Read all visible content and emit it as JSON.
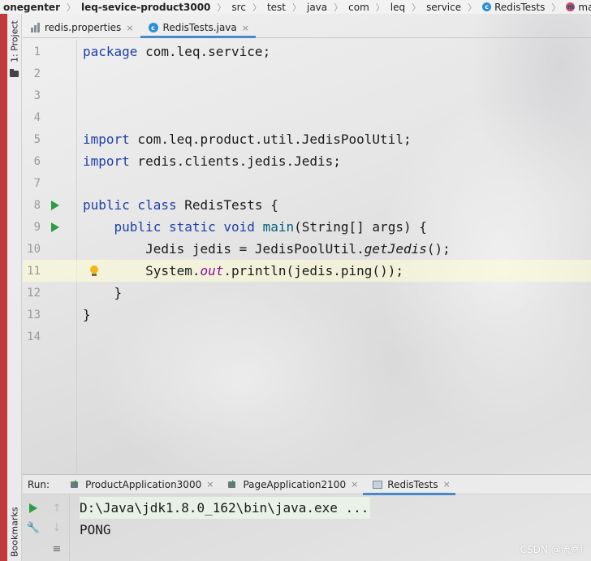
{
  "breadcrumb": [
    {
      "label": "onegenter",
      "bold": true
    },
    {
      "label": "leq-sevice-product3000",
      "bold": true
    },
    {
      "label": "src"
    },
    {
      "label": "test"
    },
    {
      "label": "java"
    },
    {
      "label": "com"
    },
    {
      "label": "leq"
    },
    {
      "label": "service"
    },
    {
      "label": "RedisTests",
      "icon": "class-icon",
      "icon_letter": "c"
    },
    {
      "label": "main",
      "icon": "method-icon",
      "icon_letter": "m"
    }
  ],
  "tool_window": {
    "project_label": "1: Project",
    "bookmarks_label": "Bookmarks"
  },
  "tabs": [
    {
      "label": "redis.properties",
      "icon": "properties-file-icon",
      "active": false,
      "close": "×"
    },
    {
      "label": "RedisTests.java",
      "icon": "java-class-icon",
      "active": true,
      "close": "×"
    }
  ],
  "editor": {
    "lines": [
      {
        "num": "1",
        "tokens": [
          {
            "t": "package",
            "c": "kw"
          },
          {
            "t": " com.leq.service;"
          }
        ]
      },
      {
        "num": "2",
        "tokens": []
      },
      {
        "num": "3",
        "tokens": []
      },
      {
        "num": "4",
        "tokens": []
      },
      {
        "num": "5",
        "tokens": [
          {
            "t": "import",
            "c": "kw"
          },
          {
            "t": " com.leq.product.util.JedisPoolUtil;"
          }
        ]
      },
      {
        "num": "6",
        "tokens": [
          {
            "t": "import",
            "c": "kw"
          },
          {
            "t": " redis.clients.jedis.Jedis;"
          }
        ]
      },
      {
        "num": "7",
        "tokens": []
      },
      {
        "num": "8",
        "run": true,
        "tokens": [
          {
            "t": "public class",
            "c": "kw"
          },
          {
            "t": " RedisTests {"
          }
        ]
      },
      {
        "num": "9",
        "run": true,
        "tokens": [
          {
            "t": "    "
          },
          {
            "t": "public static void",
            "c": "kw"
          },
          {
            "t": " "
          },
          {
            "t": "main",
            "c": "method"
          },
          {
            "t": "(String[] args) {"
          }
        ]
      },
      {
        "num": "10",
        "tokens": [
          {
            "t": "        Jedis jedis = JedisPoolUtil."
          },
          {
            "t": "getJedis",
            "c": "italic"
          },
          {
            "t": "();"
          }
        ]
      },
      {
        "num": "11",
        "current": true,
        "bulb": true,
        "tokens": [
          {
            "t": "        System."
          },
          {
            "t": "out",
            "c": "static-field"
          },
          {
            "t": ".println(jedis.ping());"
          }
        ]
      },
      {
        "num": "12",
        "tokens": [
          {
            "t": "    }"
          }
        ]
      },
      {
        "num": "13",
        "tokens": [
          {
            "t": "}"
          }
        ]
      },
      {
        "num": "14",
        "tokens": []
      }
    ]
  },
  "run_panel": {
    "label": "Run:",
    "tabs": [
      {
        "label": "ProductApplication3000",
        "icon": "app-run-icon",
        "active": false,
        "close": "×"
      },
      {
        "label": "PageApplication2100",
        "icon": "app-run-icon",
        "active": false,
        "close": "×"
      },
      {
        "label": "RedisTests",
        "icon": "test-icon",
        "active": true,
        "close": "×"
      }
    ],
    "console": [
      "D:\\Java\\jdk1.8.0_162\\bin\\java.exe ...",
      "PONG"
    ]
  },
  "watermark": "CSDN @流殇l"
}
